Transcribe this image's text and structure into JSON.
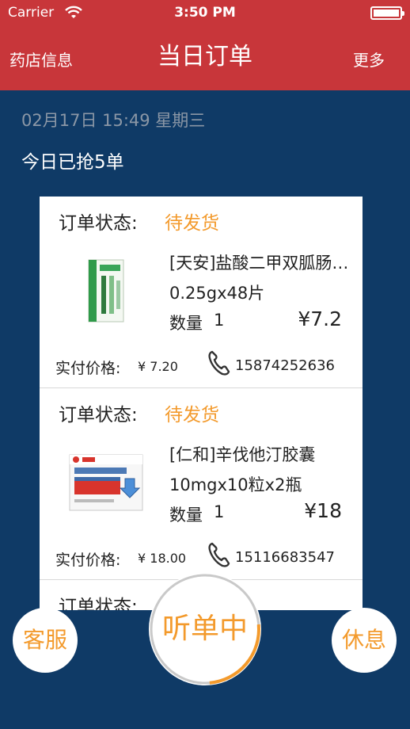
{
  "status_bar": {
    "carrier": "Carrier",
    "time": "3:50 PM"
  },
  "nav": {
    "left": "药店信息",
    "title": "当日订单",
    "right": "更多"
  },
  "date_line": "02月17日 15:49 星期三",
  "today_count": "今日已抢5单",
  "orders": [
    {
      "status_label": "订单状态:",
      "status_value": "待发货",
      "product_name": "[天安]盐酸二甲双胍肠溶片",
      "spec": "0.25gx48片",
      "qty_label": "数量",
      "qty_value": "1",
      "price": "¥7.2",
      "paid_label": "实付价格:",
      "paid_value": "¥ 7.20",
      "phone": "15874252636",
      "thumb_icon": "medicine-box-green-icon"
    },
    {
      "status_label": "订单状态:",
      "status_value": "待发货",
      "product_name": "[仁和]辛伐他汀胶囊",
      "spec": "10mgx10粒x2瓶",
      "qty_label": "数量",
      "qty_value": "1",
      "price": "¥18",
      "paid_label": "实付价格:",
      "paid_value": "¥ 18.00",
      "phone": "15116683547",
      "thumb_icon": "medicine-box-red-icon"
    },
    {
      "status_label": "订单状态:"
    }
  ],
  "buttons": {
    "service": "客服",
    "listening": "听单中",
    "rest": "休息"
  },
  "colors": {
    "nav_red": "#c8363a",
    "background_navy": "#0f3a66",
    "accent_orange": "#f39a2c"
  },
  "listening_progress": 0.25
}
